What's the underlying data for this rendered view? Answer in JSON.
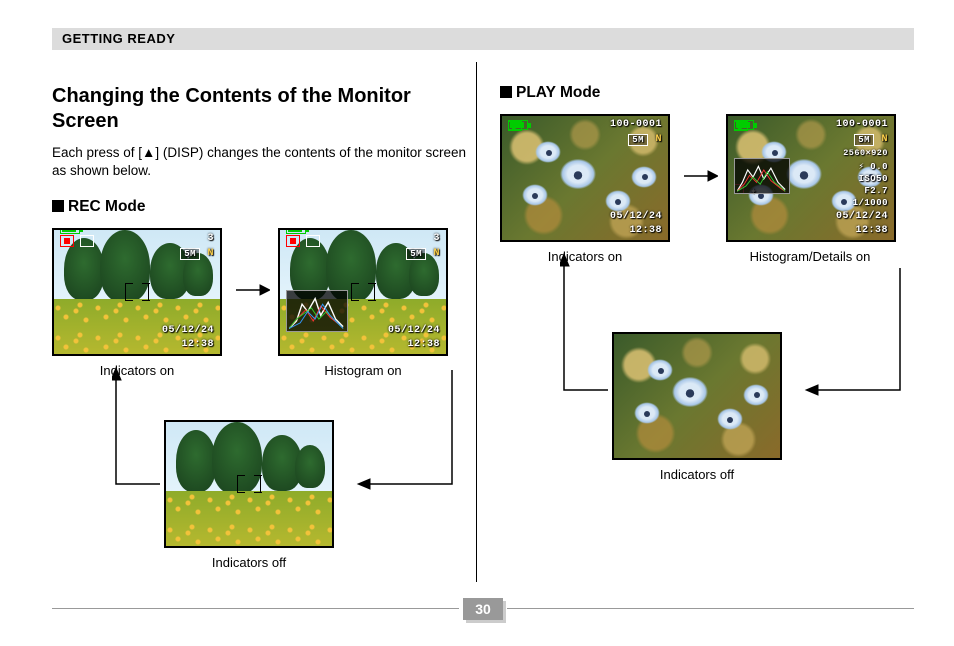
{
  "header": {
    "section_title": "GETTING READY"
  },
  "main_heading": "Changing the Contents of the Monitor Screen",
  "intro_text": "Each press of [▲] (DISP) changes the contents of the monitor screen as shown below.",
  "rec_mode": {
    "heading": "REC Mode",
    "captions": {
      "indicators_on": "Indicators on",
      "histogram_on": "Histogram on",
      "indicators_off": "Indicators off"
    },
    "osd": {
      "count": "3",
      "size": "5M",
      "quality": "N",
      "date": "05/12/24",
      "time": "12:38"
    }
  },
  "play_mode": {
    "heading": "PLAY Mode",
    "captions": {
      "indicators_on": "Indicators on",
      "histogram_details_on": "Histogram/Details on",
      "indicators_off": "Indicators off"
    },
    "osd": {
      "folder_file": "100-0001",
      "size": "5M",
      "quality": "N",
      "resolution": "2560×920",
      "ev": "0.0",
      "iso": "ISO50",
      "aperture": "F2.7",
      "shutter": "1/1000",
      "date": "05/12/24",
      "time": "12:38"
    }
  },
  "page_number": "30"
}
